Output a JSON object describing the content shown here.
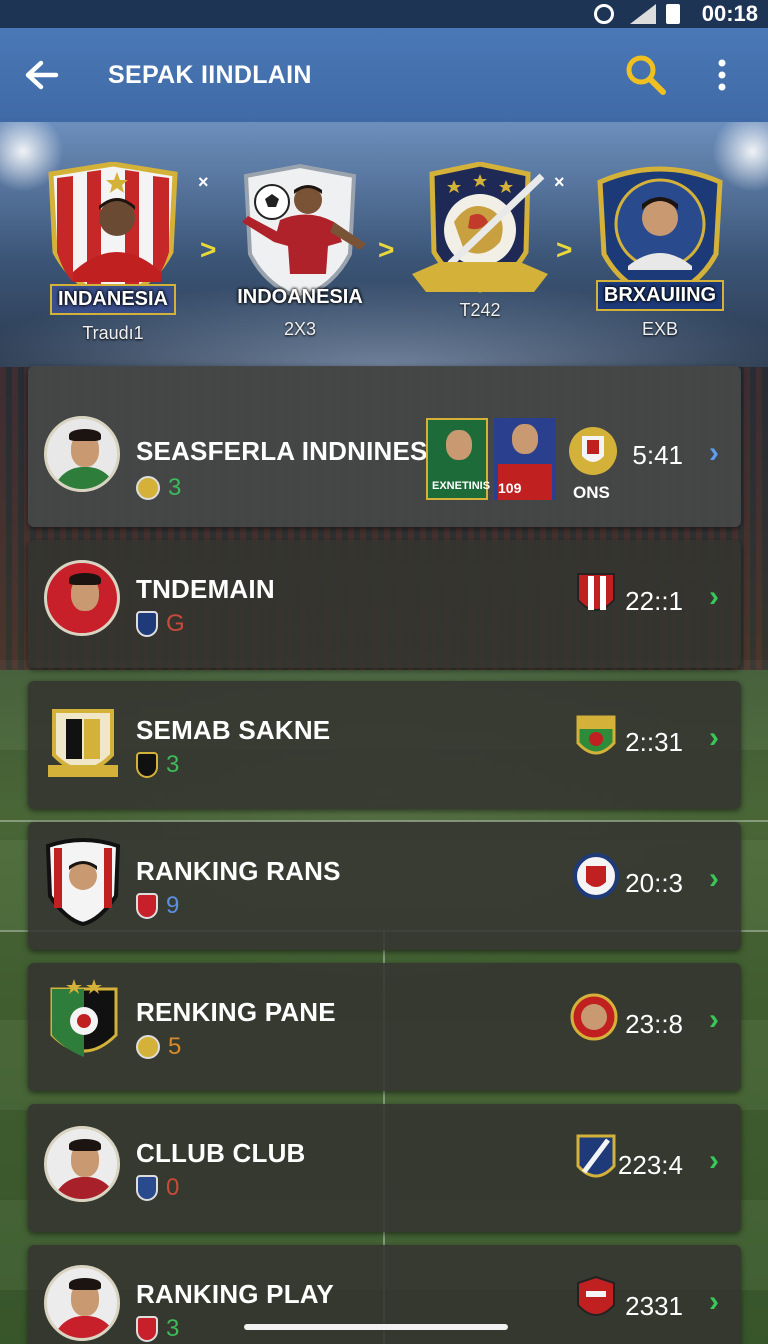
{
  "status_bar": {
    "time": "00:18"
  },
  "app_bar": {
    "title": "SEPAK IINDLAIN"
  },
  "hero": {
    "teams": [
      {
        "name": "INDANESIA",
        "sub": "Traudı1"
      },
      {
        "name": "INDOANESIA",
        "sub": "2X3"
      },
      {
        "name": "",
        "sub": "T242"
      },
      {
        "name": "BRXAUIING",
        "sub": "EXB"
      }
    ],
    "separator_x": "×",
    "arrow": ">"
  },
  "rows": [
    {
      "name": "SEASFERLA INDNINES",
      "meta_value": "3",
      "meta_color": "#3dbb5a",
      "score": "5:41",
      "extra_card_1": "EXNETINIS",
      "extra_card_2": "109",
      "extra_label": "ONS",
      "chevron_color": "#5b9ef0"
    },
    {
      "name": "TNDEMAIN",
      "meta_value": "G",
      "meta_color": "#c94a3a",
      "score": "22::1"
    },
    {
      "name": "SEMAB SAKNE",
      "meta_value": "3",
      "meta_color": "#3dbb5a",
      "score": "2::31"
    },
    {
      "name": "RANKING RANS",
      "meta_value": "9",
      "meta_color": "#5b8fe0",
      "score": "20::3"
    },
    {
      "name": "RENKING PANE",
      "meta_value": "5",
      "meta_color": "#d98a2a",
      "score": "23::8"
    },
    {
      "name": "CLLUB CLUB",
      "meta_value": "0",
      "meta_color": "#c94a3a",
      "score": "223:4"
    },
    {
      "name": "RANKING PLAY",
      "meta_value": "3",
      "meta_color": "#3dbb5a",
      "score": "2331"
    }
  ],
  "colors": {
    "accent_green": "#38c85a",
    "app_bar": "#4373ae",
    "search_icon": "#f0c020"
  },
  "icons": [
    "back-arrow-icon",
    "search-icon",
    "more-vertical-icon",
    "chevron-right-icon",
    "wifi-icon",
    "signal-icon",
    "battery-icon"
  ]
}
